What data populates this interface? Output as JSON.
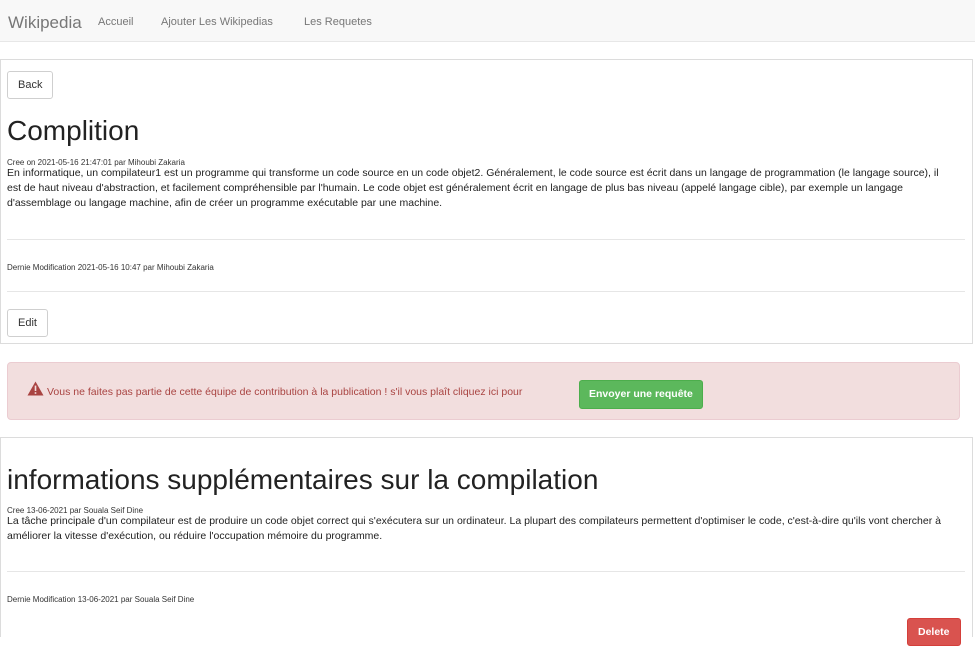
{
  "navbar": {
    "brand": "Wikipedia",
    "links": [
      "Accueil",
      "Ajouter Les Wikipedias",
      "Les Requetes"
    ]
  },
  "article": {
    "back_label": "Back",
    "title": "Complition",
    "created": "Cree on 2021-05-16 21:47:01 par Mihoubi Zakaria",
    "body": "En informatique, un compilateur1 est un programme qui transforme un code source en un code objet2. Généralement, le code source est écrit dans un langage de programmation (le langage source), il est de haut niveau d'abstraction, et facilement compréhensible par l'humain. Le code objet est généralement écrit en langage de plus bas niveau (appelé langage cible), par exemple un langage d'assemblage ou langage machine, afin de créer un programme exécutable par une machine.",
    "modified": "Dernie Modification 2021-05-16 10:47 par Mihoubi Zakaria",
    "edit_label": "Edit"
  },
  "alert": {
    "icon": "warning-icon",
    "text": "Vous ne faites pas partie de cette équipe de contribution à la publication ! s'il vous plaît cliquez ici pour",
    "button_label": "Envoyer une requête"
  },
  "section": {
    "title": "informations supplémentaires sur la compilation",
    "created": "Cree 13-06-2021 par Souala Seif Dine",
    "body": "La tâche principale d'un compilateur est de produire un code objet correct qui s'exécutera sur un ordinateur. La plupart des compilateurs permettent d'optimiser le code, c'est-à-dire qu'ils vont chercher à améliorer la vitesse d'exécution, ou réduire l'occupation mémoire du programme.",
    "modified": "Dernie Modification 13-06-2021 par Souala Seif Dine",
    "delete_label": "Delete"
  },
  "colors": {
    "success": "#5cb85c",
    "danger": "#d9534f",
    "alert_bg": "#f2dede",
    "alert_text": "#a94442"
  }
}
